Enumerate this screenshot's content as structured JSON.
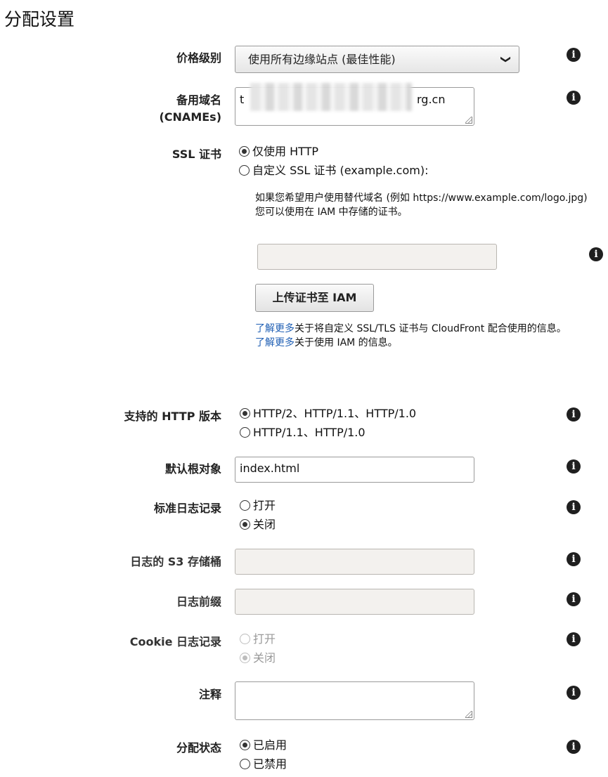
{
  "page_title": "分配设置",
  "price_class": {
    "label": "价格级别",
    "selected": "使用所有边缘站点 (最佳性能)"
  },
  "cnames": {
    "label_line1": "备用域名",
    "label_line2": "(CNAMEs)",
    "value_prefix": "t",
    "value_suffix": "rg.cn"
  },
  "ssl": {
    "label": "SSL 证书",
    "option_default": "仅使用 HTTP",
    "option_custom": "自定义 SSL 证书 (example.com):",
    "help_line1": "如果您希望用户使用替代域名 (例如 https://www.example.com/logo.jpg)",
    "help_line2": "您可以使用在 IAM 中存储的证书。",
    "upload_button": "上传证书至 IAM",
    "learn_more": "了解更多",
    "learn_more_text1": "关于将自定义 SSL/TLS 证书与 CloudFront 配合使用的信息。",
    "learn_more_text2": "关于使用 IAM 的信息。"
  },
  "http_versions": {
    "label": "支持的 HTTP 版本",
    "option1": "HTTP/2、HTTP/1.1、HTTP/1.0",
    "option2": "HTTP/1.1、HTTP/1.0"
  },
  "default_root": {
    "label": "默认根对象",
    "value": "index.html"
  },
  "logging": {
    "label": "标准日志记录",
    "on": "打开",
    "off": "关闭"
  },
  "log_bucket": {
    "label": "日志的 S3 存储桶"
  },
  "log_prefix": {
    "label": "日志前缀"
  },
  "cookie_logging": {
    "label": "Cookie 日志记录",
    "on": "打开",
    "off": "关闭"
  },
  "comment": {
    "label": "注释"
  },
  "distribution_state": {
    "label": "分配状态",
    "enabled": "已启用",
    "disabled": "已禁用"
  },
  "icons": {
    "info": "i",
    "chevron": "❯"
  },
  "colors": {
    "link": "#1f5fb4",
    "disabled_field": "#f3f1ee"
  }
}
